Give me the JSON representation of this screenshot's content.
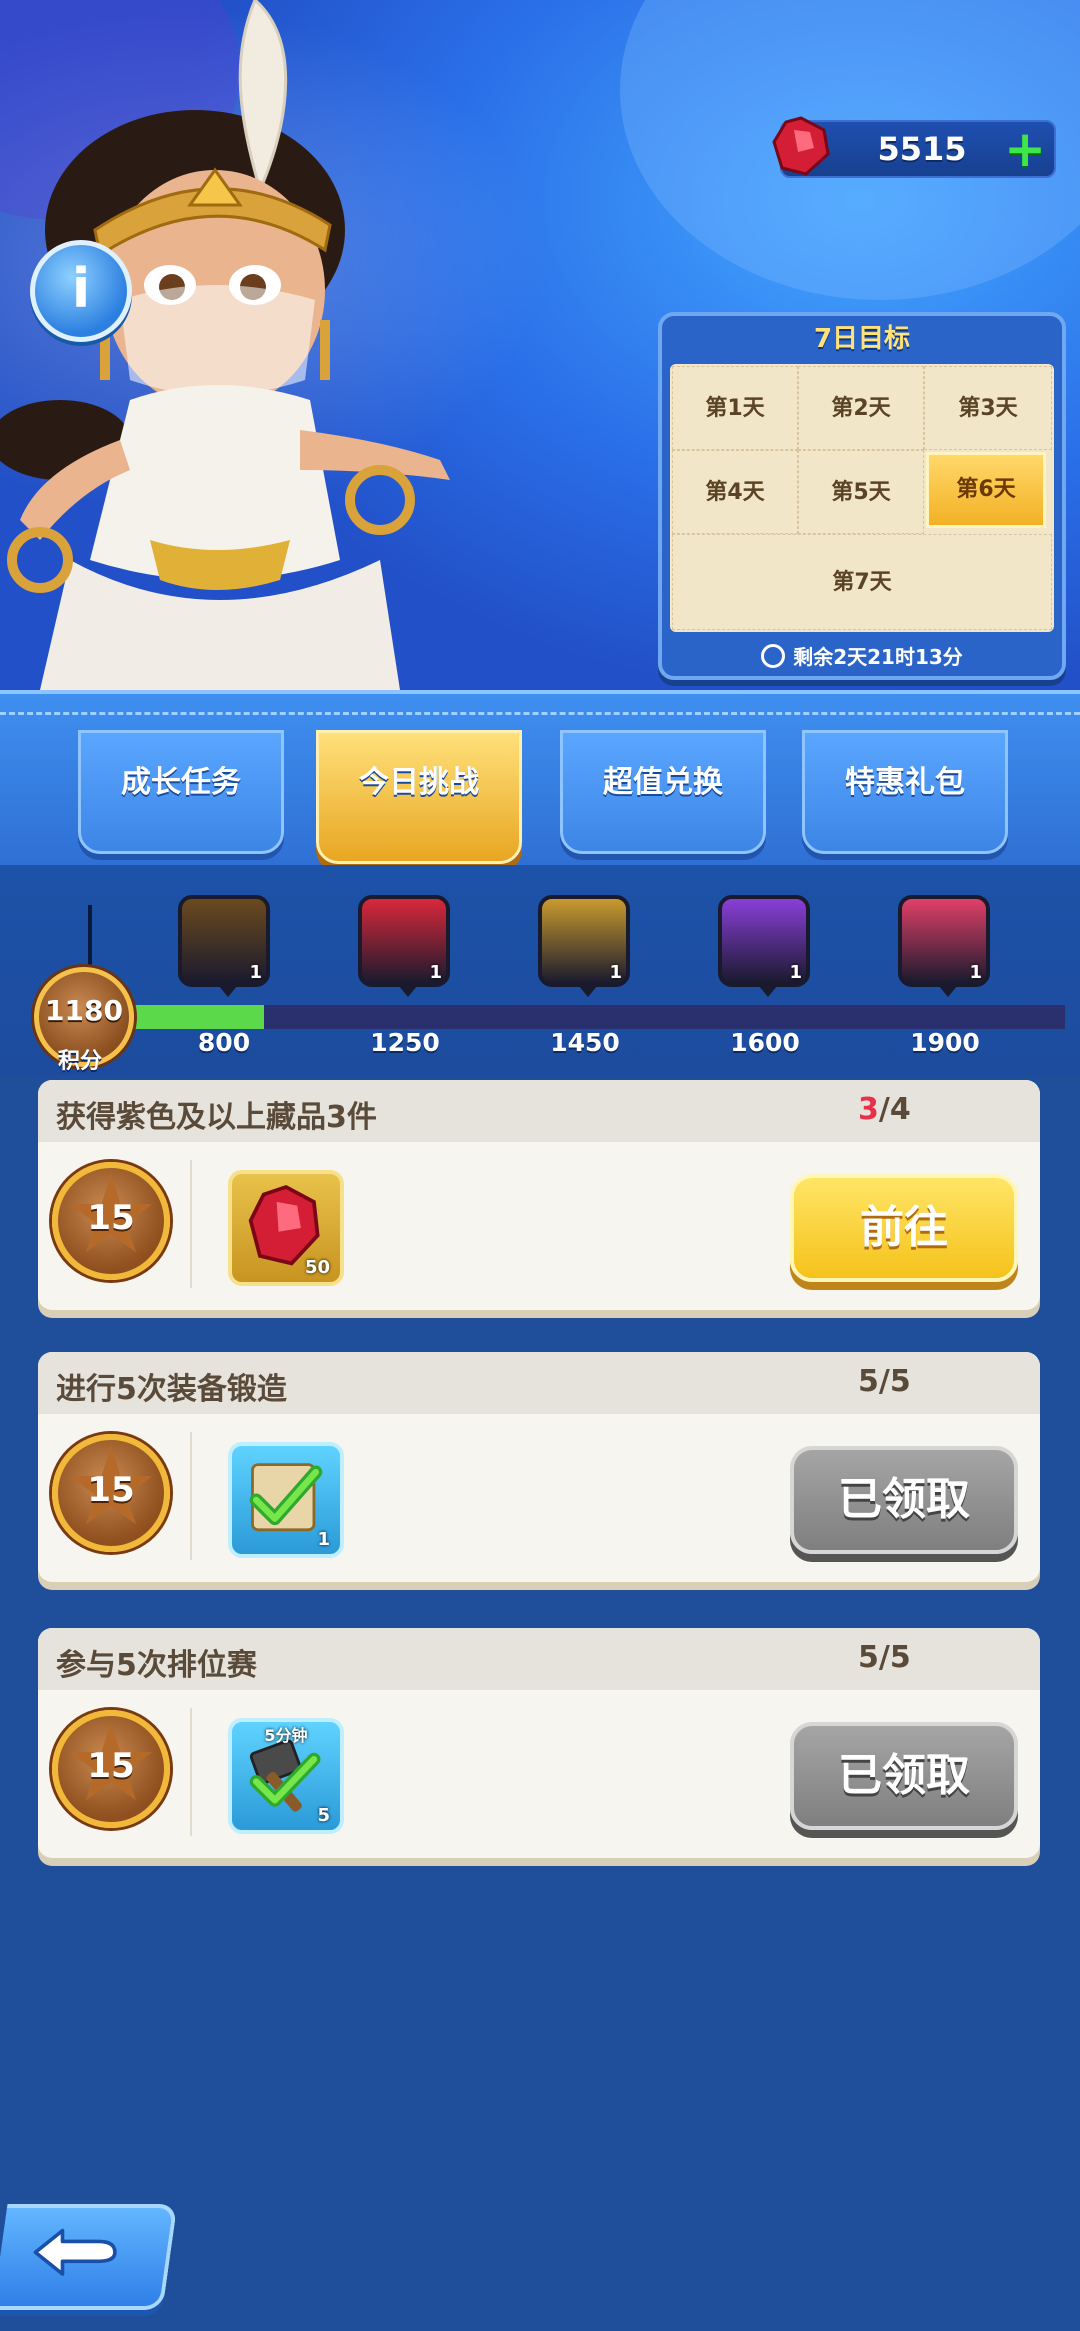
{
  "header": {
    "currency": {
      "icon": "ruby-gem-icon",
      "amount": "5515",
      "add": "+"
    },
    "info_label": "i"
  },
  "goal_panel": {
    "title": "7日目标",
    "days": [
      "第1天",
      "第2天",
      "第3天",
      "第4天",
      "第5天",
      "第6天",
      "第7天"
    ],
    "active_day": "第6天",
    "timer": "剩余2天21时13分"
  },
  "tabs": [
    {
      "label": "成长任务",
      "active": false
    },
    {
      "label": "今日挑战",
      "active": true
    },
    {
      "label": "超值兑换",
      "active": false
    },
    {
      "label": "特惠礼包",
      "active": false
    }
  ],
  "progress": {
    "points": "1180",
    "points_label": "积分",
    "fill_fraction": 0.178,
    "milestones": [
      {
        "value": "800",
        "count": "1",
        "icon": "scroll-check-icon",
        "color": "#6b4a1e"
      },
      {
        "value": "1250",
        "count": "1",
        "icon": "golden-scroll-icon",
        "color": "#d8283a"
      },
      {
        "value": "1450",
        "count": "1",
        "icon": "weapons-bundle-icon",
        "color": "#c99a2e"
      },
      {
        "value": "1600",
        "count": "1",
        "icon": "treasure-chest-icon",
        "color": "#8a3fd8"
      },
      {
        "value": "1900",
        "count": "1",
        "icon": "hero-portrait-icon",
        "color": "#e04068"
      }
    ]
  },
  "tasks": [
    {
      "title": "获得紫色及以上藏品3件",
      "current": "3",
      "total": "/4",
      "current_red": true,
      "badge": "15",
      "reward_icon": "ruby-gem-icon",
      "reward_qty": "50",
      "reward_top": "",
      "button": "前往",
      "button_state": "go"
    },
    {
      "title": "进行5次装备锻造",
      "current": "5",
      "total": "/5",
      "current_red": false,
      "badge": "15",
      "reward_icon": "scroll-check-icon",
      "reward_qty": "1",
      "reward_top": "",
      "button": "已领取",
      "button_state": "done"
    },
    {
      "title": "参与5次排位赛",
      "current": "5",
      "total": "/5",
      "current_red": false,
      "badge": "15",
      "reward_icon": "speedup-hammer-icon",
      "reward_qty": "5",
      "reward_top": "5分钟",
      "button": "已领取",
      "button_state": "done"
    }
  ],
  "footer": {
    "back_icon": "back-arrow-icon"
  }
}
